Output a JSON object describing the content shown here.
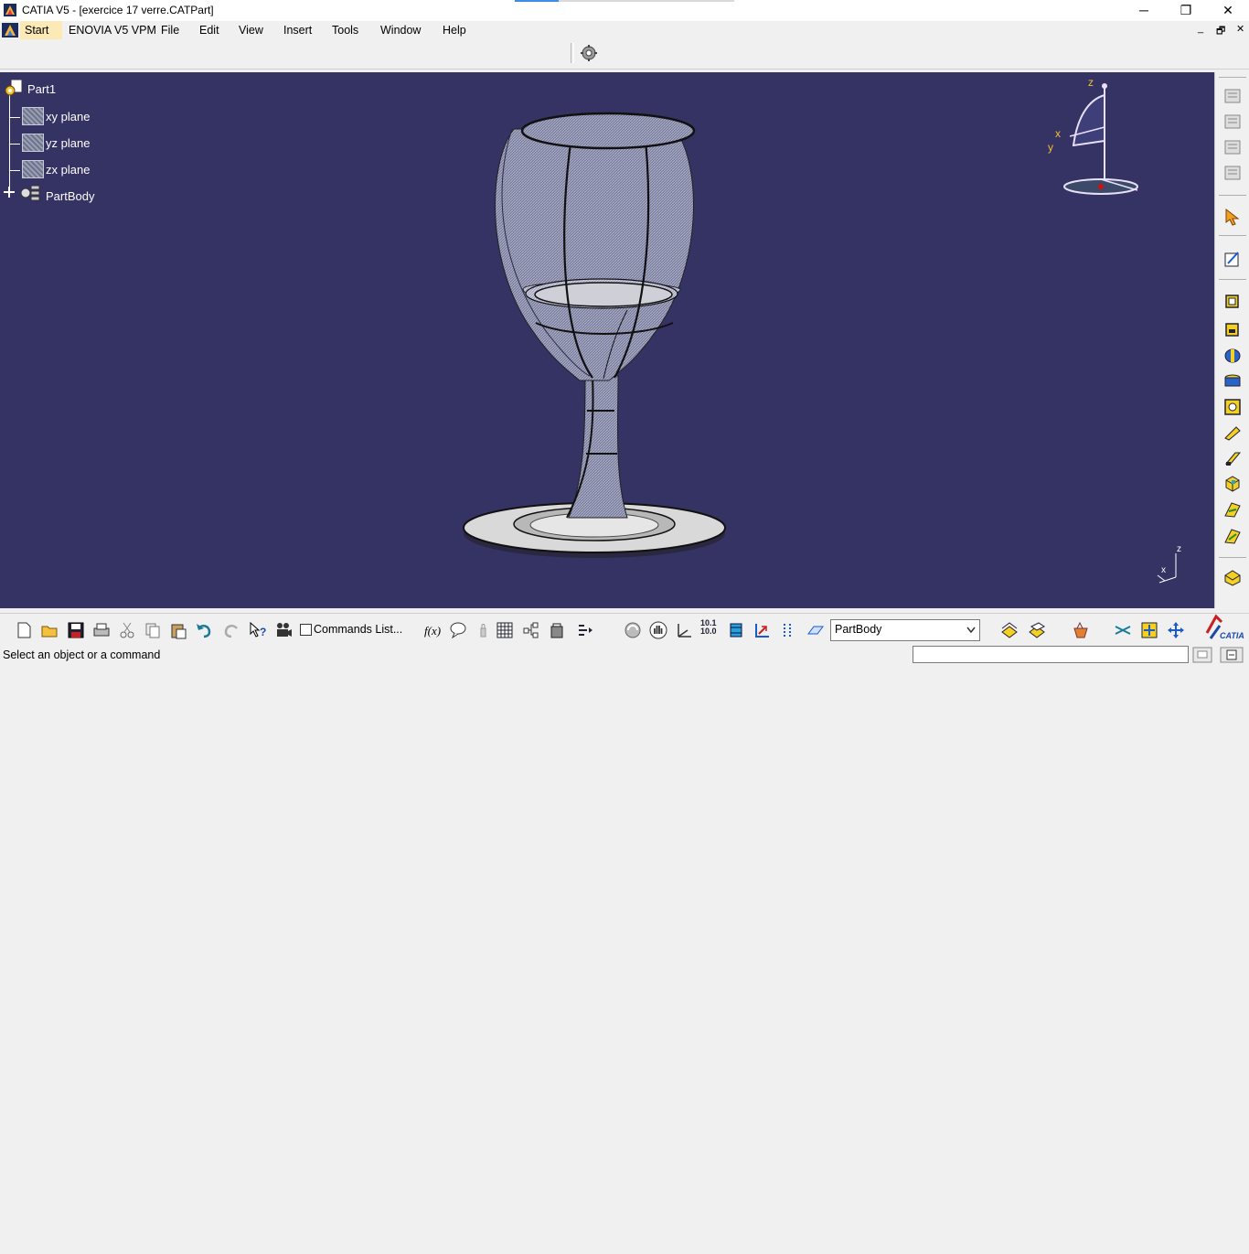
{
  "window": {
    "title": "CATIA V5 - [exercice 17 verre.CATPart]",
    "minimize": "─",
    "restore": "❐",
    "close": "✕"
  },
  "menu": {
    "items": [
      "Start",
      "ENOVIA V5 VPM",
      "File",
      "Edit",
      "View",
      "Insert",
      "Tools",
      "Window",
      "Help"
    ],
    "doc_controls": [
      "_",
      "🗗",
      "✕"
    ]
  },
  "tree": {
    "root": "Part1",
    "children": [
      "xy plane",
      "yz plane",
      "zx plane",
      "PartBody"
    ]
  },
  "compass": {
    "z": "z",
    "x": "x",
    "y": "y"
  },
  "axis_triad": {
    "z": "z",
    "x": "x"
  },
  "bottom_toolbar": {
    "commands_list_label": "Commands List...",
    "body_select_value": "PartBody",
    "scale_text": "10.1\n10.0"
  },
  "status": {
    "message": "Select an object or a command",
    "input_value": ""
  },
  "colors": {
    "viewport_bg": "#353264",
    "menu_highlight": "#fde9b5"
  }
}
